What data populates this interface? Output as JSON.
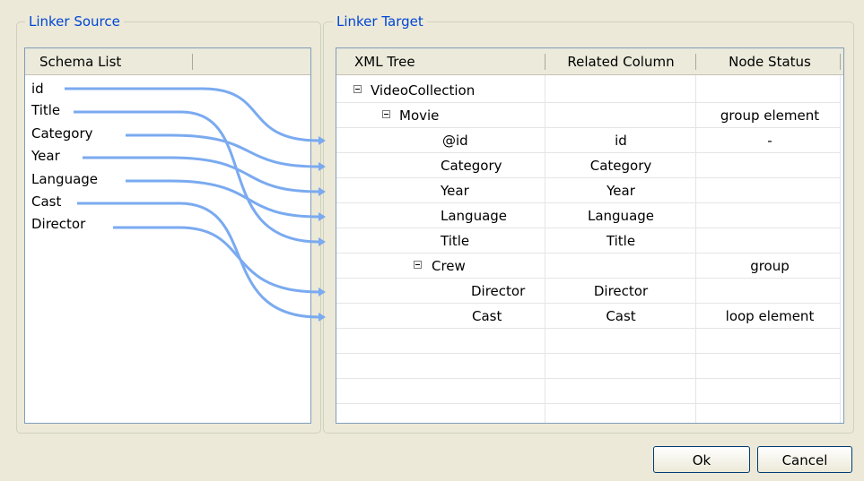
{
  "source": {
    "legend": "Linker Source",
    "header": "Schema List",
    "items": [
      "id",
      "Title",
      "Category",
      "Year",
      "Language",
      "Cast",
      "Director"
    ]
  },
  "target": {
    "legend": "Linker Target",
    "columns": [
      "XML Tree",
      "Related Column",
      "Node Status"
    ],
    "rows": [
      {
        "node": "VideoCollection",
        "related": "",
        "status": ""
      },
      {
        "node": "Movie",
        "related": "",
        "status": "group element"
      },
      {
        "node": "@id",
        "related": "id",
        "status": "-"
      },
      {
        "node": "Category",
        "related": "Category",
        "status": ""
      },
      {
        "node": "Year",
        "related": "Year",
        "status": ""
      },
      {
        "node": "Language",
        "related": "Language",
        "status": ""
      },
      {
        "node": "Title",
        "related": "Title",
        "status": ""
      },
      {
        "node": "Crew",
        "related": "",
        "status": "group"
      },
      {
        "node": "Director",
        "related": "Director",
        "status": ""
      },
      {
        "node": "Cast",
        "related": "Cast",
        "status": "loop element"
      }
    ]
  },
  "buttons": {
    "ok": "Ok",
    "cancel": "Cancel"
  },
  "colors": {
    "link_line": "#7aaaf0",
    "legend_text": "#0046d5"
  }
}
